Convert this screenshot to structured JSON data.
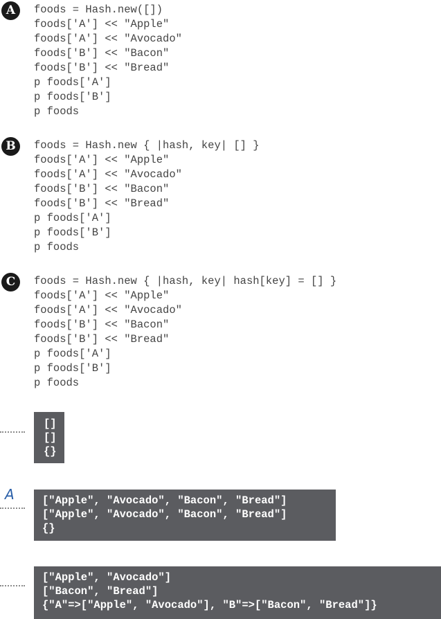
{
  "snippets": [
    {
      "label": "A",
      "lines": [
        "foods = Hash.new([])",
        "foods['A'] << \"Apple\"",
        "foods['A'] << \"Avocado\"",
        "foods['B'] << \"Bacon\"",
        "foods['B'] << \"Bread\"",
        "p foods['A']",
        "p foods['B']",
        "p foods"
      ]
    },
    {
      "label": "B",
      "lines": [
        "foods = Hash.new { |hash, key| [] }",
        "foods['A'] << \"Apple\"",
        "foods['A'] << \"Avocado\"",
        "foods['B'] << \"Bacon\"",
        "foods['B'] << \"Bread\"",
        "p foods['A']",
        "p foods['B']",
        "p foods"
      ]
    },
    {
      "label": "C",
      "lines": [
        "foods = Hash.new { |hash, key| hash[key] = [] }",
        "foods['A'] << \"Apple\"",
        "foods['A'] << \"Avocado\"",
        "foods['B'] << \"Bacon\"",
        "foods['B'] << \"Bread\"",
        "p foods['A']",
        "p foods['B']",
        "p foods"
      ]
    }
  ],
  "outputs": [
    {
      "annotation": "",
      "lines": [
        "[]",
        "[]",
        "{}"
      ]
    },
    {
      "annotation": "A",
      "lines": [
        "[\"Apple\", \"Avocado\", \"Bacon\", \"Bread\"]",
        "[\"Apple\", \"Avocado\", \"Bacon\", \"Bread\"]",
        "{}"
      ]
    },
    {
      "annotation": "",
      "lines": [
        "[\"Apple\", \"Avocado\"]",
        "[\"Bacon\", \"Bread\"]",
        "{\"A\"=>[\"Apple\", \"Avocado\"], \"B\"=>[\"Bacon\", \"Bread\"]}"
      ]
    }
  ],
  "colors": {
    "badge_bg": "#1a1a1a",
    "code_text": "#444444",
    "output_bg": "#5b5c60",
    "output_text": "#ffffff",
    "annotation": "#2a5fa8"
  }
}
